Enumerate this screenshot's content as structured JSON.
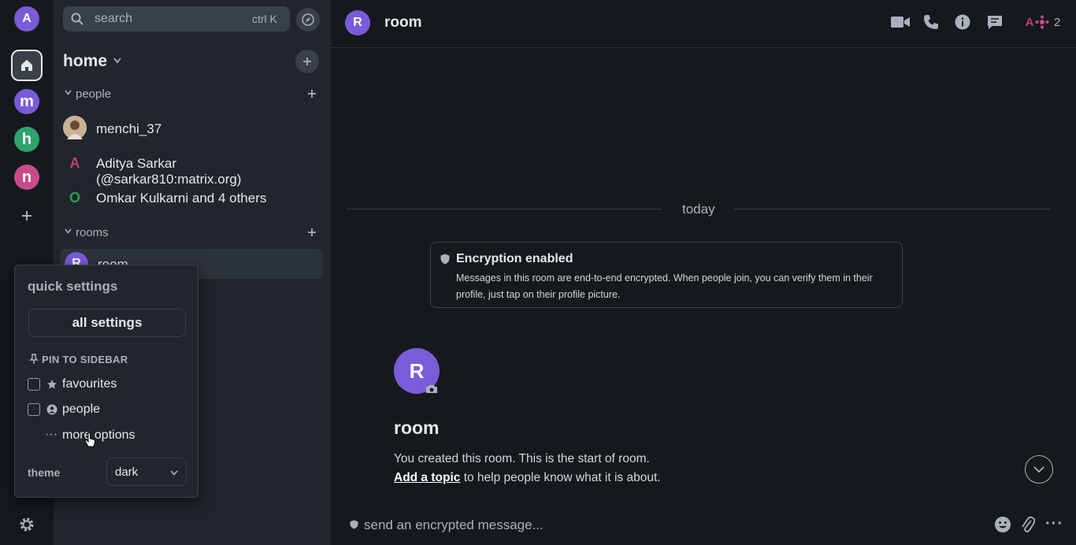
{
  "spacebar": {
    "user_initial": "A",
    "spaces": [
      {
        "letter": "m",
        "color": "#7a5bd8"
      },
      {
        "letter": "h",
        "color": "#2fa36b"
      },
      {
        "letter": "n",
        "color": "#c84b8a"
      }
    ]
  },
  "search": {
    "label": "search",
    "shortcut": "ctrl K"
  },
  "roomlist": {
    "title": "home",
    "people_section": "people",
    "people": [
      {
        "name": "menchi_37",
        "initial": "",
        "avatar_color": "#b9a48a"
      },
      {
        "name": "Aditya Sarkar (@sarkar810:matrix.org)",
        "initial": "A",
        "avatar_color": "#c33f6b"
      },
      {
        "name": "Omkar Kulkarni and 4 others",
        "initial": "O",
        "avatar_color": "#2e9e4f"
      }
    ],
    "rooms_section": "rooms",
    "room_initial": "R",
    "room_name": "room"
  },
  "quick_settings": {
    "title": "quick settings",
    "all_settings": "all settings",
    "pin_to_sidebar": "pin to sidebar",
    "favourites": "favourites",
    "people": "people",
    "more_options": "more options",
    "theme_label": "theme",
    "theme_value": "dark"
  },
  "header": {
    "room_initial": "R",
    "room_name": "room",
    "member_count": "2",
    "member_initial": "A"
  },
  "timeline": {
    "date_separator": "today",
    "encryption_title": "Encryption enabled",
    "encryption_text": "Messages in this room are end-to-end encrypted. When people join, you can verify them in their profile, just tap on their profile picture.",
    "room_initial": "R",
    "room_name": "room",
    "intro_text": "You created this room. This is the start of room.",
    "add_topic": "Add a topic",
    "add_topic_suffix": " to help people know what it is about."
  },
  "composer": {
    "placeholder": "send an encrypted message..."
  },
  "colors": {
    "accent": "#7a5bd8",
    "background": "#15191e",
    "panel": "#21262c",
    "home_green": "#0dbd8b"
  }
}
